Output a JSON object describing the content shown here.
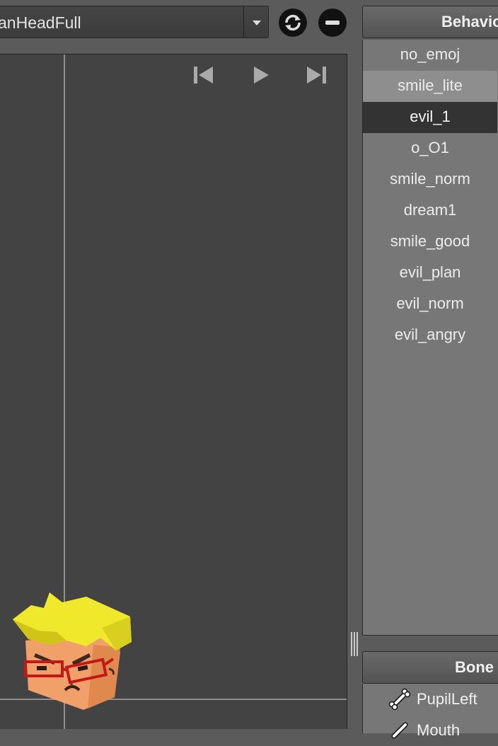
{
  "model_selector": {
    "value": "anHeadFull"
  },
  "viewport": {
    "transport": {
      "prev_icon": "skip-to-start-icon",
      "play_icon": "play-icon",
      "next_icon": "skip-to-end-icon"
    }
  },
  "behaviour_panel": {
    "title": "Behavio",
    "items": [
      {
        "label": "no_emoj",
        "state": "normal"
      },
      {
        "label": "smile_lite",
        "state": "hover"
      },
      {
        "label": "evil_1",
        "state": "selected"
      },
      {
        "label": "o_O1",
        "state": "normal"
      },
      {
        "label": "smile_norm",
        "state": "normal"
      },
      {
        "label": "dream1",
        "state": "normal"
      },
      {
        "label": "smile_good",
        "state": "normal"
      },
      {
        "label": "evil_plan",
        "state": "normal"
      },
      {
        "label": "evil_norm",
        "state": "normal"
      },
      {
        "label": "evil_angry",
        "state": "normal"
      }
    ]
  },
  "bones_panel": {
    "title": "Bone",
    "items": [
      {
        "label": "PupilLeft",
        "icon": "bone-icon"
      },
      {
        "label": "Mouth",
        "icon": "bone-icon"
      }
    ]
  },
  "colors": {
    "background": "#5b5b5b",
    "viewport": "#434343",
    "panel": "#777777",
    "selected_row": "#333333",
    "hair": "#f0e82a",
    "skin": "#f2a06a",
    "glasses": "#c41818"
  }
}
